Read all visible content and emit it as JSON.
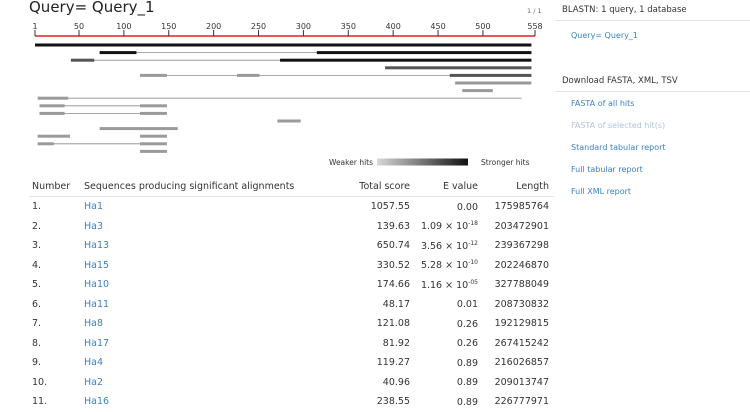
{
  "query": {
    "title": "Query= Query_1",
    "page_indicator": "1 / 1"
  },
  "axis": {
    "min": 1,
    "max": 558,
    "ticks": [
      1,
      50,
      100,
      150,
      200,
      250,
      300,
      350,
      400,
      450,
      500,
      558
    ]
  },
  "legend": {
    "weaker": "Weaker hits",
    "stronger": "Stronger hits"
  },
  "alignment_tracks": [
    {
      "segments": [
        {
          "from": 1,
          "to": 554,
          "strength": "strong"
        }
      ]
    },
    {
      "line": [
        73,
        554
      ],
      "segments": [
        {
          "from": 73,
          "to": 114,
          "strength": "strong"
        },
        {
          "from": 315,
          "to": 554,
          "strength": "strong"
        }
      ]
    },
    {
      "line": [
        41,
        554
      ],
      "segments": [
        {
          "from": 41,
          "to": 67,
          "strength": "medium"
        },
        {
          "from": 274,
          "to": 554,
          "strength": "strong"
        }
      ]
    },
    {
      "line": [
        391,
        554
      ],
      "segments": [
        {
          "from": 391,
          "to": 554,
          "strength": "medium"
        }
      ]
    },
    {
      "line": [
        118,
        554
      ],
      "segments": [
        {
          "from": 118,
          "to": 148,
          "strength": "weak"
        },
        {
          "from": 226,
          "to": 251,
          "strength": "weak"
        },
        {
          "from": 463,
          "to": 554,
          "strength": "medium"
        }
      ]
    },
    {
      "line": [
        469,
        554
      ],
      "segments": [
        {
          "from": 469,
          "to": 554,
          "strength": "weak"
        }
      ]
    },
    {
      "segments": [
        {
          "from": 477,
          "to": 511,
          "strength": "weak"
        }
      ]
    },
    {
      "line": [
        4,
        543
      ],
      "segments": [
        {
          "from": 4,
          "to": 38,
          "strength": "weak"
        }
      ]
    },
    {
      "line": [
        6,
        148
      ],
      "segments": [
        {
          "from": 6,
          "to": 34,
          "strength": "weak"
        },
        {
          "from": 118,
          "to": 148,
          "strength": "weak"
        }
      ]
    },
    {
      "line": [
        6,
        148
      ],
      "segments": [
        {
          "from": 6,
          "to": 34,
          "strength": "weak"
        },
        {
          "from": 118,
          "to": 148,
          "strength": "weak"
        }
      ]
    },
    {
      "segments": [
        {
          "from": 271,
          "to": 297,
          "strength": "weak"
        }
      ]
    },
    {
      "segments": [
        {
          "from": 73,
          "to": 160,
          "strength": "weak"
        }
      ]
    },
    {
      "line": [
        4,
        40
      ],
      "segments": [
        {
          "from": 4,
          "to": 40,
          "strength": "weak"
        },
        {
          "from": 118,
          "to": 148,
          "strength": "weak"
        }
      ]
    },
    {
      "line": [
        4,
        148
      ],
      "segments": [
        {
          "from": 4,
          "to": 22,
          "strength": "weak"
        },
        {
          "from": 118,
          "to": 148,
          "strength": "weak"
        }
      ]
    },
    {
      "segments": [
        {
          "from": 118,
          "to": 148,
          "strength": "weak"
        }
      ]
    }
  ],
  "colors": {
    "axis": "#e02020",
    "strong": "#111111",
    "medium": "#555555",
    "weak": "#9a9a9a",
    "line": "#8a8a8a",
    "link": "#3b82c4",
    "link_disabled": "#b0c4dd"
  },
  "table": {
    "headers": {
      "number": "Number",
      "description": "Sequences producing significant alignments",
      "score": "Total score",
      "evalue": "E value",
      "length": "Length"
    },
    "rows": [
      {
        "num": "1.",
        "name": "Ha1",
        "score": "1057.55",
        "evalue_base": "0.00",
        "evalue_exp": "",
        "length": "175985764"
      },
      {
        "num": "2.",
        "name": "Ha3",
        "score": "139.63",
        "evalue_base": "1.09 × 10",
        "evalue_exp": "-18",
        "length": "203472901"
      },
      {
        "num": "3.",
        "name": "Ha13",
        "score": "650.74",
        "evalue_base": "3.56 × 10",
        "evalue_exp": "-12",
        "length": "239367298"
      },
      {
        "num": "4.",
        "name": "Ha15",
        "score": "330.52",
        "evalue_base": "5.28 × 10",
        "evalue_exp": "-10",
        "length": "202246870"
      },
      {
        "num": "5.",
        "name": "Ha10",
        "score": "174.66",
        "evalue_base": "1.16 × 10",
        "evalue_exp": "-05",
        "length": "327788049"
      },
      {
        "num": "6.",
        "name": "Ha11",
        "score": "48.17",
        "evalue_base": "0.01",
        "evalue_exp": "",
        "length": "208730832"
      },
      {
        "num": "7.",
        "name": "Ha8",
        "score": "121.08",
        "evalue_base": "0.26",
        "evalue_exp": "",
        "length": "192129815"
      },
      {
        "num": "8.",
        "name": "Ha17",
        "score": "81.92",
        "evalue_base": "0.26",
        "evalue_exp": "",
        "length": "267415242"
      },
      {
        "num": "9.",
        "name": "Ha4",
        "score": "119.27",
        "evalue_base": "0.89",
        "evalue_exp": "",
        "length": "216026857"
      },
      {
        "num": "10.",
        "name": "Ha2",
        "score": "40.96",
        "evalue_base": "0.89",
        "evalue_exp": "",
        "length": "209013747"
      },
      {
        "num": "11.",
        "name": "Ha16",
        "score": "238.55",
        "evalue_base": "0.89",
        "evalue_exp": "",
        "length": "226777971"
      }
    ]
  },
  "sidebar": {
    "title": "BLASTN: 1 query, 1 database",
    "query_link": "Query= Query_1",
    "download_title": "Download FASTA, XML, TSV",
    "links": [
      {
        "label": "FASTA of all hits",
        "enabled": true
      },
      {
        "label": "FASTA of selected hit(s)",
        "enabled": false
      },
      {
        "label": "Standard tabular report",
        "enabled": true
      },
      {
        "label": "Full tabular report",
        "enabled": true
      },
      {
        "label": "Full XML report",
        "enabled": true
      }
    ]
  }
}
